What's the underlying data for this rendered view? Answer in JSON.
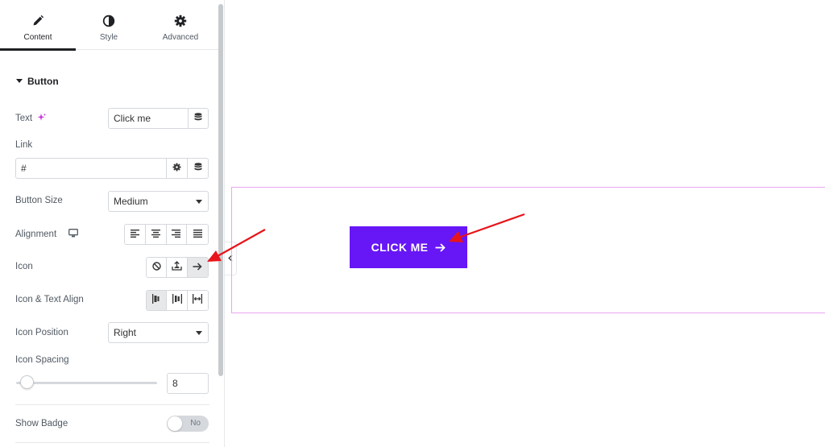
{
  "tabs": [
    {
      "label": "Content",
      "icon": "pencil-icon",
      "active": true
    },
    {
      "label": "Style",
      "icon": "half-circle-icon",
      "active": false
    },
    {
      "label": "Advanced",
      "icon": "gear-icon",
      "active": false
    }
  ],
  "section": {
    "title": "Button"
  },
  "fields": {
    "text": {
      "label": "Text",
      "value": "Click me",
      "ai_icon": "sparkle-icon"
    },
    "link": {
      "label": "Link",
      "value": "#"
    },
    "button_size": {
      "label": "Button Size",
      "value": "Medium"
    },
    "alignment": {
      "label": "Alignment",
      "device_icon": "desktop-icon"
    },
    "icon": {
      "label": "Icon",
      "selected": "arrow-right"
    },
    "icon_text_align": {
      "label": "Icon & Text Align"
    },
    "icon_position": {
      "label": "Icon Position",
      "value": "Right"
    },
    "icon_spacing": {
      "label": "Icon Spacing",
      "value": "8"
    },
    "show_badge": {
      "label": "Show Badge",
      "toggle_text": "No"
    }
  },
  "canvas": {
    "button_label": "CLICK ME"
  },
  "colors": {
    "accent": "#6716f6",
    "outline": "#e9a7f1",
    "annotation": "#e8141b"
  }
}
